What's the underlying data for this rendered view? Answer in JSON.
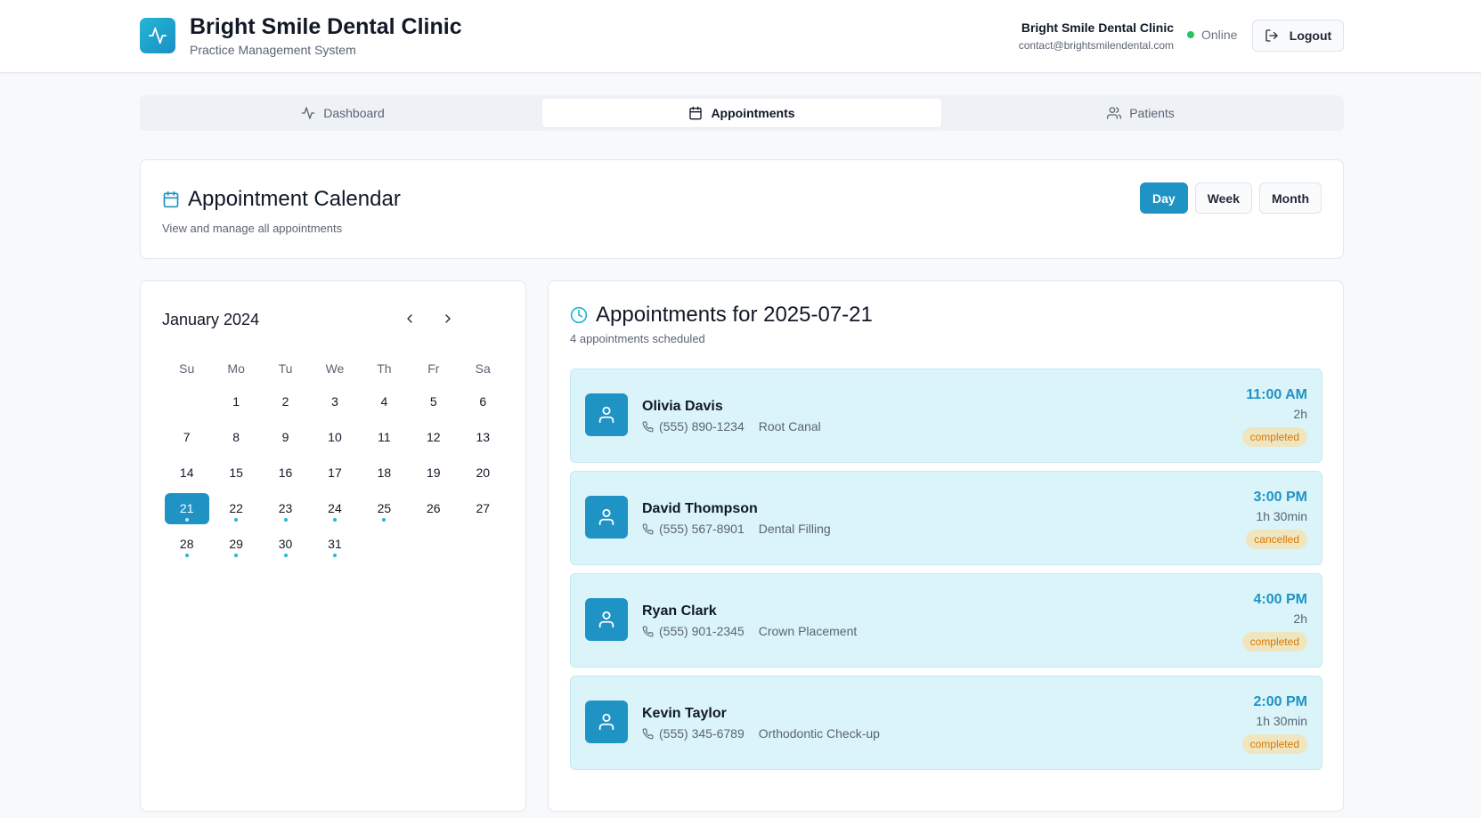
{
  "header": {
    "title": "Bright Smile Dental Clinic",
    "subtitle": "Practice Management System",
    "org_name": "Bright Smile Dental Clinic",
    "org_email": "contact@brightsmilendental.com",
    "status": "Online",
    "logout_label": "Logout",
    "logo_icon": "activity-icon"
  },
  "tabs": [
    {
      "label": "Dashboard",
      "icon": "activity-icon"
    },
    {
      "label": "Appointments",
      "icon": "calendar-icon",
      "active": true
    },
    {
      "label": "Patients",
      "icon": "users-icon"
    }
  ],
  "calendar_header": {
    "title": "Appointment Calendar",
    "subtitle": "View and manage all appointments",
    "views": [
      "Day",
      "Week",
      "Month"
    ],
    "active_view": "Day"
  },
  "mini_calendar": {
    "month_label": "January 2024",
    "weekdays": [
      "Su",
      "Mo",
      "Tu",
      "We",
      "Th",
      "Fr",
      "Sa"
    ],
    "first_weekday_index": 1,
    "days_in_month": 31,
    "selected_day": 21,
    "days_with_appointments": [
      21,
      22,
      23,
      24,
      25,
      28,
      29,
      30,
      31
    ]
  },
  "appointments": {
    "title": "Appointments for 2025-07-21",
    "count_text": "4 appointments scheduled",
    "items": [
      {
        "name": "Olivia Davis",
        "phone": "(555) 890-1234",
        "treatment": "Root Canal",
        "time": "11:00 AM",
        "duration": "2h",
        "status": "completed"
      },
      {
        "name": "David Thompson",
        "phone": "(555) 567-8901",
        "treatment": "Dental Filling",
        "time": "3:00 PM",
        "duration": "1h 30min",
        "status": "cancelled"
      },
      {
        "name": "Ryan Clark",
        "phone": "(555) 901-2345",
        "treatment": "Crown Placement",
        "time": "4:00 PM",
        "duration": "2h",
        "status": "completed"
      },
      {
        "name": "Kevin Taylor",
        "phone": "(555) 345-6789",
        "treatment": "Orthodontic Check-up",
        "time": "2:00 PM",
        "duration": "1h 30min",
        "status": "completed"
      }
    ]
  },
  "colors": {
    "primary": "#1f93c4",
    "accent": "#22b6d6",
    "online": "#22c55e",
    "badge_bg": "#efe6bf",
    "badge_text": "#d97706",
    "card_bg": "#daf4f9"
  }
}
